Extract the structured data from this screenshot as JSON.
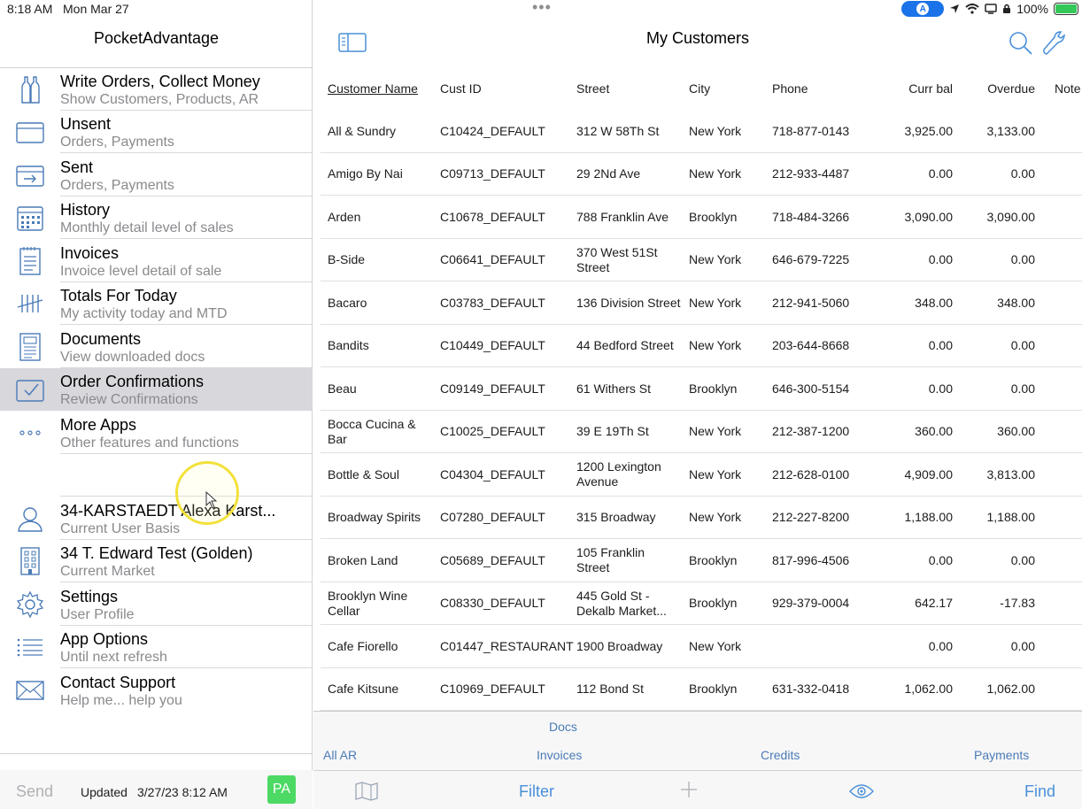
{
  "status": {
    "time": "8:18 AM",
    "date": "Mon Mar 27",
    "pill": "A",
    "battery": "100%"
  },
  "sidebar": {
    "title": "PocketAdvantage",
    "items": [
      {
        "label": "Write Orders, Collect Money",
        "sub": "Show Customers, Products, AR",
        "icon": "bottles-icon"
      },
      {
        "label": "Unsent",
        "sub": "Orders, Payments",
        "icon": "outbox-icon"
      },
      {
        "label": "Sent",
        "sub": "Orders, Payments",
        "icon": "sent-tray-icon"
      },
      {
        "label": "History",
        "sub": "Monthly detail level of sales",
        "icon": "calendar-icon"
      },
      {
        "label": "Invoices",
        "sub": "Invoice level detail of sale",
        "icon": "notepad-icon"
      },
      {
        "label": "Totals For Today",
        "sub": "My activity today and MTD",
        "icon": "tally-icon"
      },
      {
        "label": "Documents",
        "sub": "View downloaded docs",
        "icon": "document-icon"
      },
      {
        "label": "Order Confirmations",
        "sub": "Review Confirmations",
        "icon": "checkbox-icon"
      },
      {
        "label": "More Apps",
        "sub": "Other features and functions",
        "icon": "more-dots-icon"
      },
      {
        "label": "34-KARSTAEDT  Alexa Karst...",
        "sub": "Current User Basis",
        "icon": "user-icon"
      },
      {
        "label": "34 T. Edward Test (Golden)",
        "sub": "Current Market",
        "icon": "building-icon"
      },
      {
        "label": "Settings",
        "sub": "User Profile",
        "icon": "gear-icon"
      },
      {
        "label": "App Options",
        "sub": "Until next refresh",
        "icon": "list-icon"
      },
      {
        "label": "Contact Support",
        "sub": "Help me... help you",
        "icon": "envelope-icon"
      }
    ],
    "footer": {
      "send": "Send",
      "updated_label": "Updated",
      "updated_value": "3/27/23  8:12 AM",
      "badge": "PA"
    }
  },
  "main": {
    "title": "My Customers",
    "columns": [
      "Customer Name",
      "Cust ID",
      "Street",
      "City",
      "Phone",
      "Curr bal",
      "Overdue",
      "Note"
    ],
    "rows": [
      {
        "name": "All & Sundry",
        "id": "C10424_DEFAULT",
        "street": "312 W 58Th St",
        "city": "New York",
        "phone": "718-877-0143",
        "bal": "3,925.00",
        "overdue": "3,133.00"
      },
      {
        "name": "Amigo By Nai",
        "id": "C09713_DEFAULT",
        "street": "29 2Nd Ave",
        "city": "New York",
        "phone": "212-933-4487",
        "bal": "0.00",
        "overdue": "0.00"
      },
      {
        "name": "Arden",
        "id": "C10678_DEFAULT",
        "street": "788 Franklin Ave",
        "city": "Brooklyn",
        "phone": "718-484-3266",
        "bal": "3,090.00",
        "overdue": "3,090.00"
      },
      {
        "name": "B-Side",
        "id": "C06641_DEFAULT",
        "street": "370 West 51St Street",
        "city": "New York",
        "phone": "646-679-7225",
        "bal": "0.00",
        "overdue": "0.00"
      },
      {
        "name": "Bacaro",
        "id": "C03783_DEFAULT",
        "street": "136 Division Street",
        "city": "New York",
        "phone": "212-941-5060",
        "bal": "348.00",
        "overdue": "348.00"
      },
      {
        "name": "Bandits",
        "id": "C10449_DEFAULT",
        "street": "44 Bedford Street",
        "city": "New York",
        "phone": "203-644-8668",
        "bal": "0.00",
        "overdue": "0.00"
      },
      {
        "name": "Beau",
        "id": "C09149_DEFAULT",
        "street": "61 Withers St",
        "city": "Brooklyn",
        "phone": "646-300-5154",
        "bal": "0.00",
        "overdue": "0.00"
      },
      {
        "name": "Bocca Cucina & Bar",
        "id": "C10025_DEFAULT",
        "street": "39 E 19Th St",
        "city": "New York",
        "phone": "212-387-1200",
        "bal": "360.00",
        "overdue": "360.00"
      },
      {
        "name": "Bottle & Soul",
        "id": "C04304_DEFAULT",
        "street": "1200 Lexington Avenue",
        "city": "New York",
        "phone": "212-628-0100",
        "bal": "4,909.00",
        "overdue": "3,813.00"
      },
      {
        "name": "Broadway Spirits",
        "id": "C07280_DEFAULT",
        "street": "315 Broadway",
        "city": "New York",
        "phone": "212-227-8200",
        "bal": "1,188.00",
        "overdue": "1,188.00"
      },
      {
        "name": "Broken Land",
        "id": "C05689_DEFAULT",
        "street": "105 Franklin Street",
        "city": "Brooklyn",
        "phone": "817-996-4506",
        "bal": "0.00",
        "overdue": "0.00"
      },
      {
        "name": "Brooklyn Wine Cellar",
        "id": "C08330_DEFAULT",
        "street": "445 Gold St - Dekalb Market...",
        "city": "Brooklyn",
        "phone": "929-379-0004",
        "bal": "642.17",
        "overdue": "-17.83"
      },
      {
        "name": "Cafe Fiorello",
        "id": "C01447_RESTAURANT",
        "street": "1900 Broadway",
        "city": "New York",
        "phone": "",
        "bal": "0.00",
        "overdue": "0.00"
      },
      {
        "name": "Cafe Kitsune",
        "id": "C10969_DEFAULT",
        "street": "112 Bond St",
        "city": "Brooklyn",
        "phone": "631-332-0418",
        "bal": "1,062.00",
        "overdue": "1,062.00"
      }
    ],
    "docs": "Docs",
    "tabs": [
      "All AR",
      "Invoices",
      "Credits",
      "Payments"
    ],
    "toolbar": {
      "filter": "Filter",
      "find": "Find"
    }
  },
  "colors": {
    "accent": "#4a90d9",
    "selected_row": "#d7d7dc",
    "badge_green": "#4cd964"
  }
}
